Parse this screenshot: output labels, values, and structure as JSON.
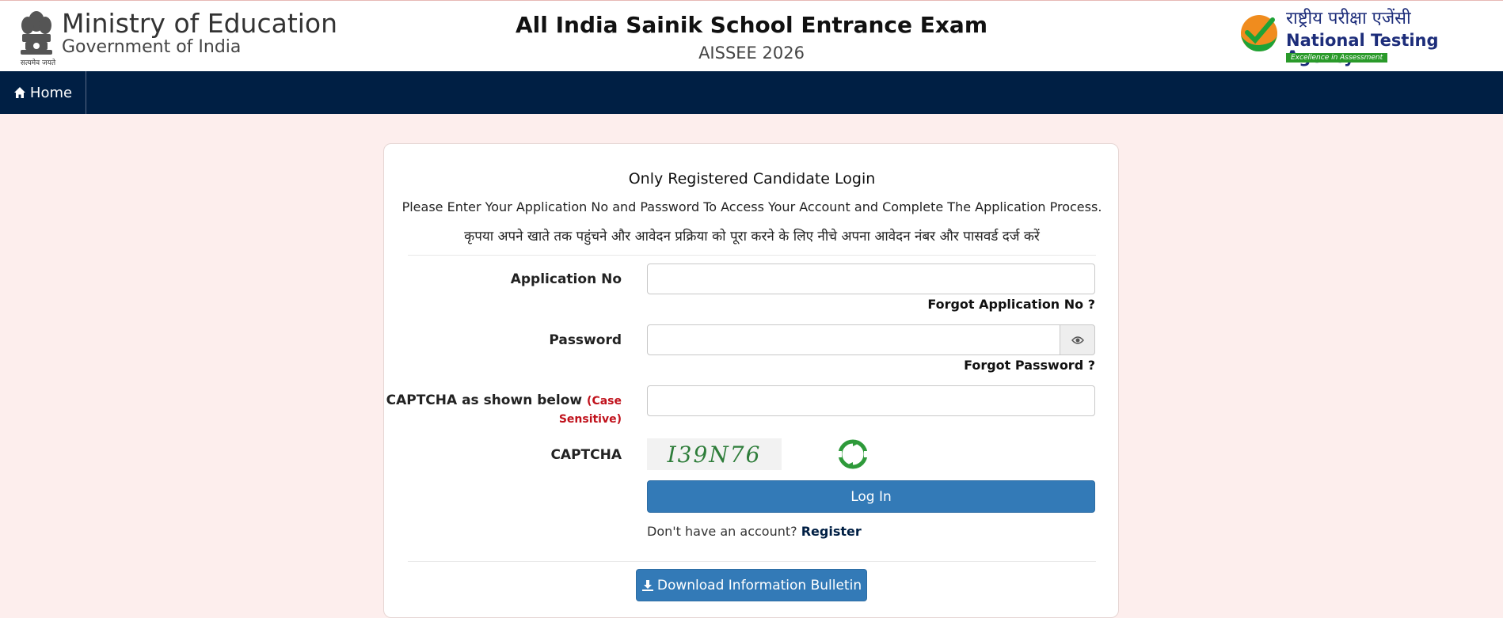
{
  "header": {
    "ministry": "Ministry of Education",
    "government": "Government of India",
    "emblem_motto": "सत्यमेव जयते",
    "exam_title": "All India Sainik School Entrance Exam",
    "exam_subtitle": "AISSEE 2026",
    "nta_hindi": "राष्ट्रीय परीक्षा एजेंसी",
    "nta_english": "National Testing Agency",
    "nta_tagline": "Excellence in Assessment"
  },
  "nav": {
    "home_label": "Home"
  },
  "login": {
    "title": "Only Registered Candidate Login",
    "instruction_en": "Please Enter Your Application No and Password To Access Your Account and Complete The Application Process.",
    "instruction_hi": "कृपया अपने खाते तक पहुंचने और आवेदन प्रक्रिया को पूरा करने के लिए नीचे अपना आवेदन नंबर और पासवर्ड दर्ज करें",
    "application_label": "Application No",
    "application_value": "",
    "forgot_application": "Forgot Application No ?",
    "password_label": "Password",
    "password_value": "",
    "forgot_password": "Forgot Password ?",
    "captcha_input_label": "CAPTCHA as shown below",
    "case_sensitive_line1": "(Case",
    "case_sensitive_line2": "Sensitive)",
    "captcha_value": "",
    "captcha_label": "CAPTCHA",
    "captcha_text": "I39N76",
    "login_button": "Log In",
    "no_account_text": "Don't have an account?",
    "register_link": "Register",
    "download_button": "Download Information Bulletin"
  },
  "colors": {
    "navbar": "#001f44",
    "page_background": "#fdeeed",
    "primary_button": "#337ab7",
    "case_sensitive": "#c0111b"
  },
  "icons": {
    "home": "home-icon",
    "eye": "eye-icon",
    "refresh": "refresh-icon",
    "download": "download-icon"
  }
}
